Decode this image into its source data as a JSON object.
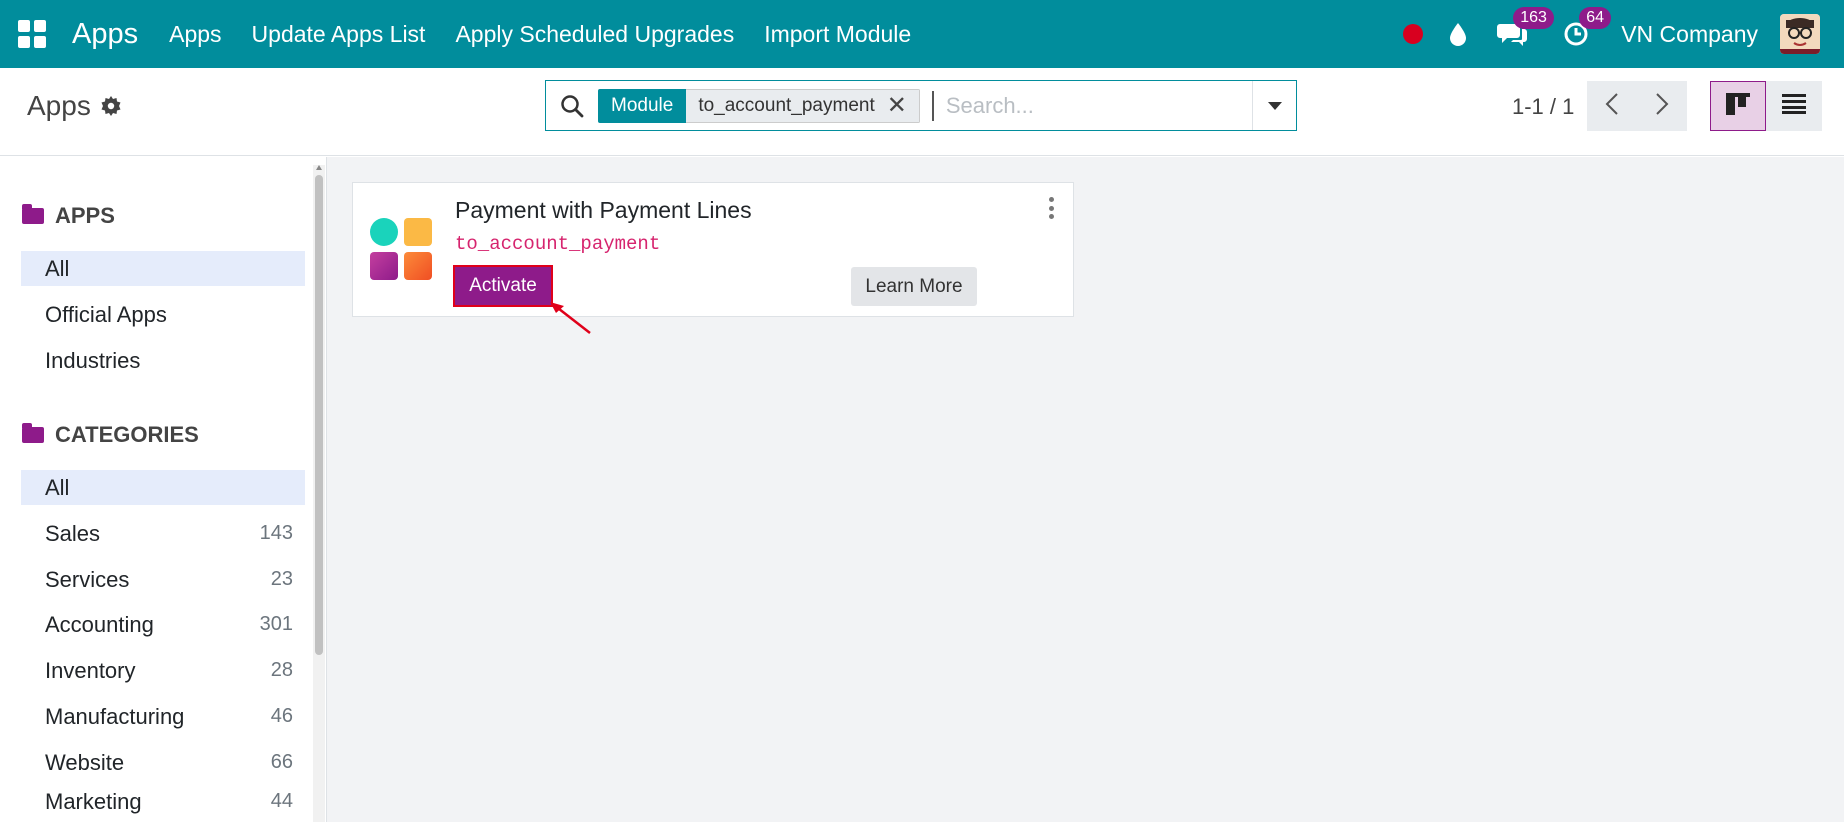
{
  "navbar": {
    "brand": "Apps",
    "menu": [
      "Apps",
      "Update Apps List",
      "Apply Scheduled Upgrades",
      "Import Module"
    ],
    "messages_count": "163",
    "activities_count": "64",
    "company": "VN Company",
    "icons": [
      "apps-grid-icon",
      "record-dot-icon",
      "drop-icon",
      "chat-icon",
      "clock-icon"
    ]
  },
  "control": {
    "breadcrumb": "Apps",
    "search": {
      "facet_key": "Module",
      "facet_value": "to_account_payment",
      "placeholder": "Search..."
    },
    "pager": "1-1 / 1"
  },
  "sidebar": {
    "apps_title": "APPS",
    "apps_items": [
      {
        "label": "All",
        "active": true
      },
      {
        "label": "Official Apps"
      },
      {
        "label": "Industries"
      }
    ],
    "categories_title": "CATEGORIES",
    "category_items": [
      {
        "label": "All",
        "count": "",
        "active": true
      },
      {
        "label": "Sales",
        "count": "143"
      },
      {
        "label": "Services",
        "count": "23"
      },
      {
        "label": "Accounting",
        "count": "301"
      },
      {
        "label": "Inventory",
        "count": "28"
      },
      {
        "label": "Manufacturing",
        "count": "46"
      },
      {
        "label": "Website",
        "count": "66"
      },
      {
        "label": "Marketing",
        "count": "44"
      }
    ]
  },
  "card": {
    "title": "Payment with Payment Lines",
    "technical_name": "to_account_payment",
    "activate_label": "Activate",
    "learn_more_label": "Learn More"
  },
  "colors": {
    "navbar": "#018d9c",
    "primary": "#8e1b8a",
    "annotation": "#e0001a"
  }
}
